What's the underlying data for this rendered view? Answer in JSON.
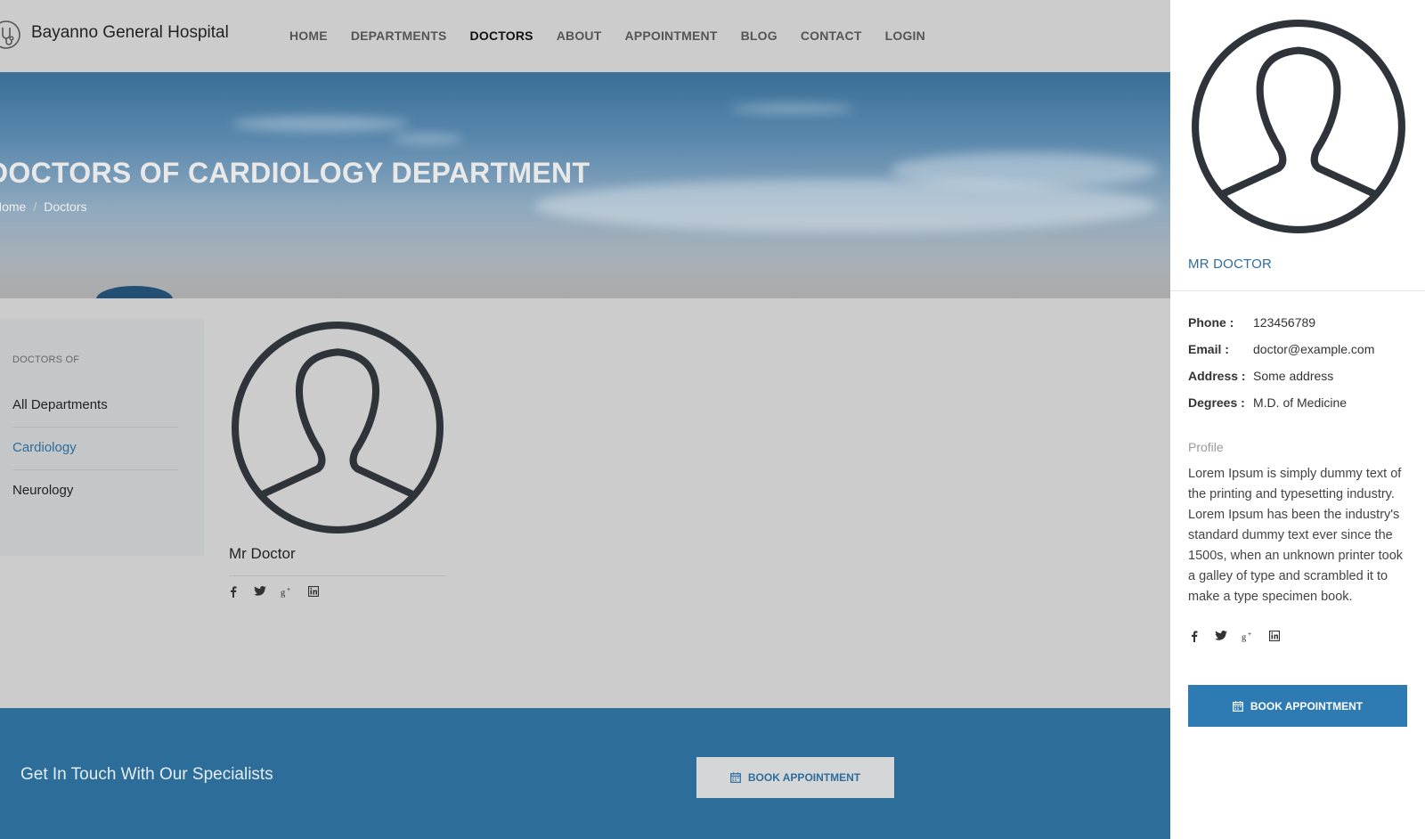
{
  "brand": {
    "name": "Bayanno General Hospital"
  },
  "nav": [
    {
      "label": "HOME"
    },
    {
      "label": "DEPARTMENTS"
    },
    {
      "label": "DOCTORS"
    },
    {
      "label": "ABOUT"
    },
    {
      "label": "APPOINTMENT"
    },
    {
      "label": "BLOG"
    },
    {
      "label": "CONTACT"
    },
    {
      "label": "LOGIN"
    }
  ],
  "hero": {
    "title": "DOCTORS OF CARDIOLOGY DEPARTMENT",
    "breadcrumb": [
      "Home",
      "Doctors"
    ]
  },
  "sidebar": {
    "heading": "DOCTORS OF",
    "items": [
      {
        "label": "All Departments"
      },
      {
        "label": "Cardiology"
      },
      {
        "label": "Neurology"
      }
    ]
  },
  "doctor_card": {
    "name": "Mr Doctor"
  },
  "cta": {
    "text": "Get In Touch With Our Specialists",
    "button": "BOOK APPOINTMENT"
  },
  "panel": {
    "name": "MR DOCTOR",
    "info": [
      {
        "label": "Phone :",
        "value": "123456789"
      },
      {
        "label": "Email :",
        "value": "doctor@example.com"
      },
      {
        "label": "Address :",
        "value": "Some address"
      },
      {
        "label": "Degrees :",
        "value": "M.D. of Medicine"
      }
    ],
    "profile_label": "Profile",
    "profile_text": "Lorem Ipsum is simply dummy text of the printing and typesetting industry. Lorem Ipsum has been the industry's standard dummy text ever since the 1500s, when an unknown printer took a galley of type and scrambled it to make a type specimen book.",
    "button": "BOOK APPOINTMENT"
  },
  "icons": {
    "logo": "stethoscope-icon",
    "social": [
      "facebook-icon",
      "twitter-icon",
      "google-plus-icon",
      "linkedin-icon"
    ],
    "button": "calendar-icon"
  },
  "colors": {
    "accent": "#2e6d9c",
    "button": "#2e7bb3",
    "cta_band": "#2d6d99",
    "overlay": "#cccccc"
  }
}
